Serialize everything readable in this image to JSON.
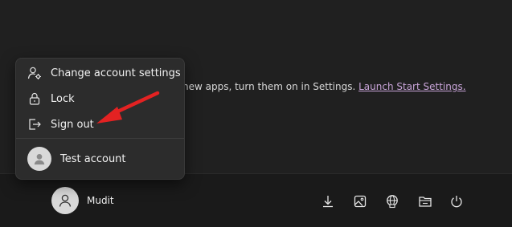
{
  "start": {
    "heading_partial": "",
    "info_text": "new apps, turn them on in Settings. ",
    "info_link": "Launch Start Settings."
  },
  "menu": {
    "items": [
      {
        "label": "Change account settings",
        "icon": "account-settings-icon"
      },
      {
        "label": "Lock",
        "icon": "lock-icon"
      },
      {
        "label": "Sign out",
        "icon": "sign-out-icon"
      }
    ],
    "account": {
      "label": "Test account",
      "icon": "user-avatar-icon"
    }
  },
  "footer": {
    "user_name": "Mudit",
    "icons": [
      "downloads-icon",
      "pictures-icon",
      "network-icon",
      "file-explorer-icon",
      "power-icon"
    ]
  },
  "annotation": {
    "arrow_color": "#e32222"
  },
  "colors": {
    "background": "#1c1c1c",
    "menu_bg": "#2c2c2c",
    "link": "#c8a4d8"
  }
}
